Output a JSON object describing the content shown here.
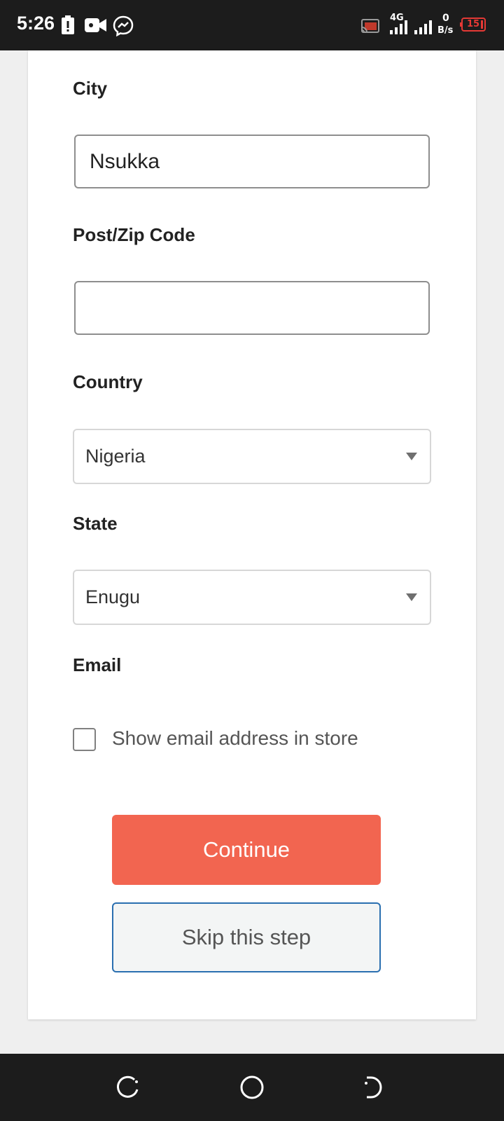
{
  "status_bar": {
    "time": "5:26",
    "network": "4G",
    "data_speed_value": "0",
    "data_speed_unit": "B/s",
    "battery_level": "15",
    "icons": [
      "battery-alert-icon",
      "video-call-icon",
      "messenger-icon",
      "cast-icon",
      "signal-icon",
      "signal-icon",
      "battery-icon"
    ],
    "battery_color": "#e53935"
  },
  "form": {
    "city": {
      "label": "City",
      "value": "Nsukka",
      "placeholder": ""
    },
    "postcode": {
      "label": "Post/Zip Code",
      "value": "",
      "placeholder": ""
    },
    "country": {
      "label": "Country",
      "selected": "Nigeria"
    },
    "state": {
      "label": "State",
      "selected": "Enugu"
    },
    "email": {
      "label": "Email",
      "checkbox_label": "Show email address in store",
      "checked": false
    }
  },
  "buttons": {
    "continue_label": "Continue",
    "skip_label": "Skip this step"
  },
  "colors": {
    "accent": "#f26550",
    "secondary_border": "#2a6fb0"
  },
  "nav_bar": {
    "icons": [
      "recent-apps-icon",
      "home-icon",
      "back-icon"
    ]
  }
}
